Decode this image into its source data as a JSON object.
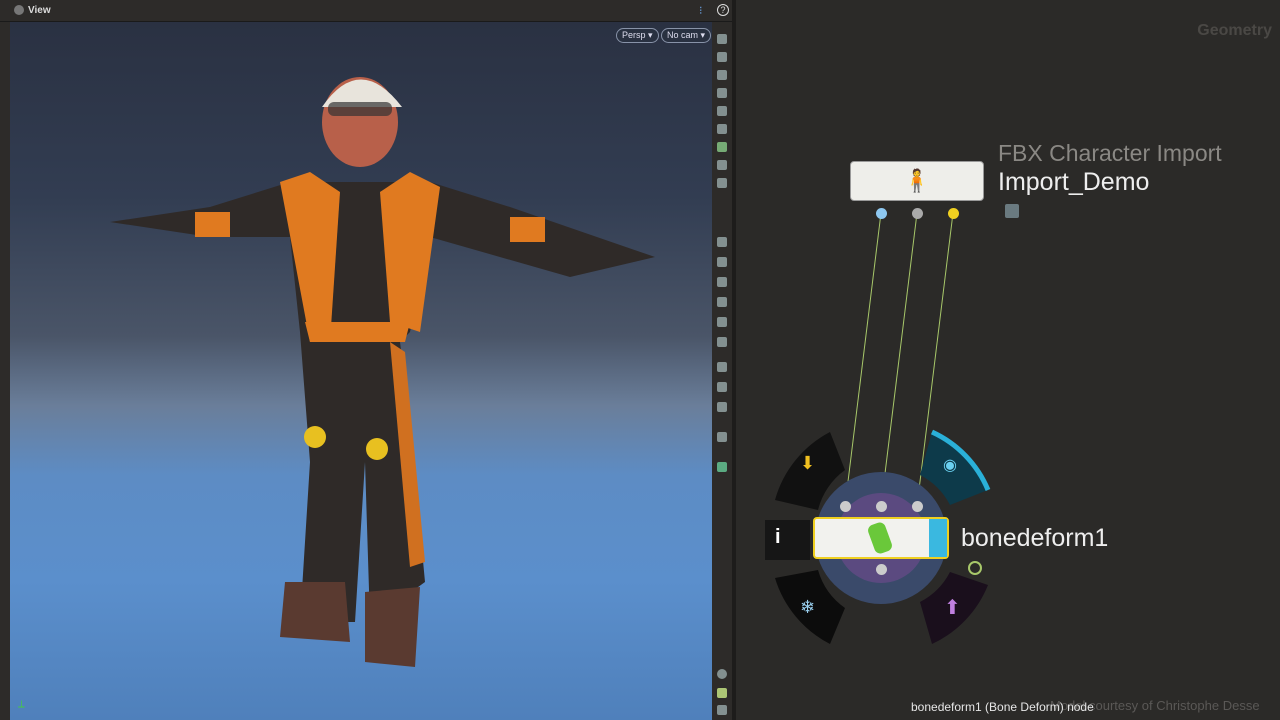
{
  "viewer": {
    "title": "View",
    "persp_label": "Persp",
    "cam_label": "No cam",
    "help": "?"
  },
  "network": {
    "context_label": "Geometry",
    "node_fbx": {
      "type": "FBX Character Import",
      "name": "Import_Demo",
      "icon": "character-icon",
      "locked": true
    },
    "node_bone": {
      "name": "bonedeform1",
      "icon": "bone-icon"
    },
    "ring_icons": [
      "arrow-down-icon",
      "eye-icon",
      "info-icon",
      "snowflake-icon",
      "bypass-icon"
    ],
    "info_glyph": "i"
  },
  "status": {
    "text": "bonedeform1 (Bone Deform) node",
    "credit": "Model courtesy of Christophe Desse"
  },
  "colors": {
    "wire": "#a8c86a",
    "input1": "#8ec8f0",
    "input3": "#f0d020",
    "display": "#2ab0d8"
  }
}
